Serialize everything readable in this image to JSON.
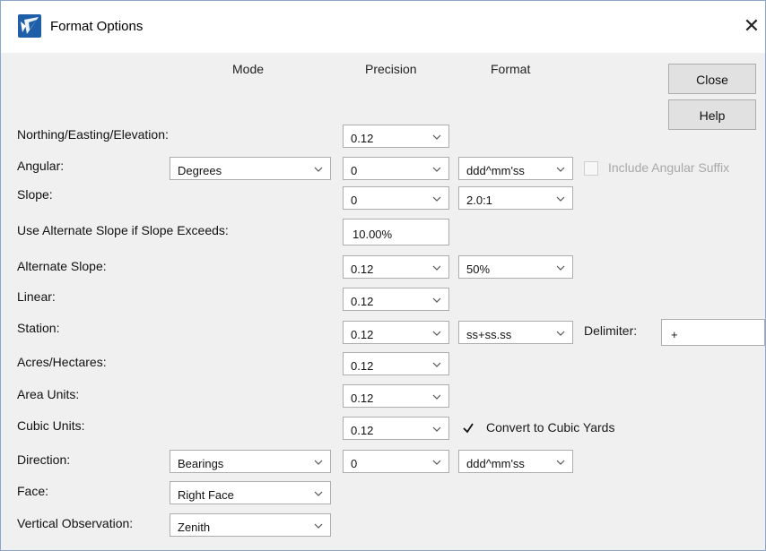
{
  "window": {
    "title": "Format Options",
    "close_glyph": "✕"
  },
  "headers": {
    "mode": "Mode",
    "precision": "Precision",
    "format": "Format"
  },
  "buttons": {
    "close": "Close",
    "help": "Help"
  },
  "rows": {
    "northing": {
      "label": "Northing/Easting/Elevation:",
      "precision": "0.12"
    },
    "angular": {
      "label": "Angular:",
      "mode": "Degrees",
      "precision": "0",
      "format": "ddd^mm'ss",
      "suffix_label": "Include Angular Suffix",
      "suffix_checked": false,
      "suffix_enabled": false
    },
    "slope": {
      "label": "Slope:",
      "precision": "0",
      "format": "2.0:1"
    },
    "alt_slope_exceeds": {
      "label": "Use Alternate Slope if Slope Exceeds:",
      "value": "10.00%"
    },
    "alt_slope": {
      "label": "Alternate Slope:",
      "precision": "0.12",
      "format": "50%"
    },
    "linear": {
      "label": "Linear:",
      "precision": "0.12"
    },
    "station": {
      "label": "Station:",
      "precision": "0.12",
      "format": "ss+ss.ss",
      "delimiter_label": "Delimiter:",
      "delimiter_value": "+"
    },
    "acres": {
      "label": "Acres/Hectares:",
      "precision": "0.12"
    },
    "area": {
      "label": "Area Units:",
      "precision": "0.12"
    },
    "cubic": {
      "label": "Cubic Units:",
      "precision": "0.12",
      "convert_label": "Convert to Cubic Yards",
      "convert_checked": true
    },
    "direction": {
      "label": "Direction:",
      "mode": "Bearings",
      "precision": "0",
      "format": "ddd^mm'ss"
    },
    "face": {
      "label": "Face:",
      "mode": "Right Face"
    },
    "vertical": {
      "label": "Vertical Observation:",
      "mode": "Zenith"
    }
  },
  "icons": {
    "app": "format-options-app-icon",
    "dropdown": "chevron-down-icon",
    "check": "checkmark-icon"
  }
}
